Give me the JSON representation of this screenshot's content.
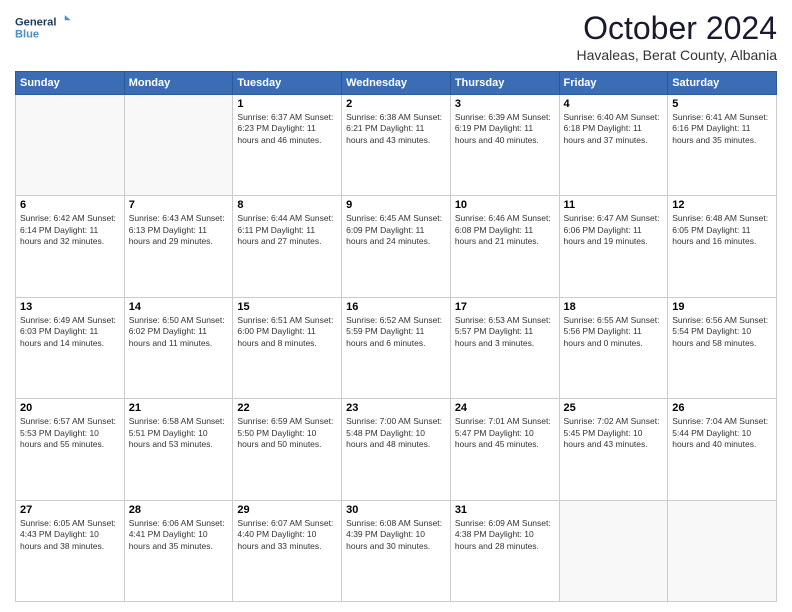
{
  "logo": {
    "line1": "General",
    "line2": "Blue",
    "icon_color": "#4a90c4"
  },
  "header": {
    "month_title": "October 2024",
    "subtitle": "Havaleas, Berat County, Albania"
  },
  "weekdays": [
    "Sunday",
    "Monday",
    "Tuesday",
    "Wednesday",
    "Thursday",
    "Friday",
    "Saturday"
  ],
  "weeks": [
    [
      {
        "day": "",
        "info": ""
      },
      {
        "day": "",
        "info": ""
      },
      {
        "day": "1",
        "info": "Sunrise: 6:37 AM\nSunset: 6:23 PM\nDaylight: 11 hours\nand 46 minutes."
      },
      {
        "day": "2",
        "info": "Sunrise: 6:38 AM\nSunset: 6:21 PM\nDaylight: 11 hours\nand 43 minutes."
      },
      {
        "day": "3",
        "info": "Sunrise: 6:39 AM\nSunset: 6:19 PM\nDaylight: 11 hours\nand 40 minutes."
      },
      {
        "day": "4",
        "info": "Sunrise: 6:40 AM\nSunset: 6:18 PM\nDaylight: 11 hours\nand 37 minutes."
      },
      {
        "day": "5",
        "info": "Sunrise: 6:41 AM\nSunset: 6:16 PM\nDaylight: 11 hours\nand 35 minutes."
      }
    ],
    [
      {
        "day": "6",
        "info": "Sunrise: 6:42 AM\nSunset: 6:14 PM\nDaylight: 11 hours\nand 32 minutes."
      },
      {
        "day": "7",
        "info": "Sunrise: 6:43 AM\nSunset: 6:13 PM\nDaylight: 11 hours\nand 29 minutes."
      },
      {
        "day": "8",
        "info": "Sunrise: 6:44 AM\nSunset: 6:11 PM\nDaylight: 11 hours\nand 27 minutes."
      },
      {
        "day": "9",
        "info": "Sunrise: 6:45 AM\nSunset: 6:09 PM\nDaylight: 11 hours\nand 24 minutes."
      },
      {
        "day": "10",
        "info": "Sunrise: 6:46 AM\nSunset: 6:08 PM\nDaylight: 11 hours\nand 21 minutes."
      },
      {
        "day": "11",
        "info": "Sunrise: 6:47 AM\nSunset: 6:06 PM\nDaylight: 11 hours\nand 19 minutes."
      },
      {
        "day": "12",
        "info": "Sunrise: 6:48 AM\nSunset: 6:05 PM\nDaylight: 11 hours\nand 16 minutes."
      }
    ],
    [
      {
        "day": "13",
        "info": "Sunrise: 6:49 AM\nSunset: 6:03 PM\nDaylight: 11 hours\nand 14 minutes."
      },
      {
        "day": "14",
        "info": "Sunrise: 6:50 AM\nSunset: 6:02 PM\nDaylight: 11 hours\nand 11 minutes."
      },
      {
        "day": "15",
        "info": "Sunrise: 6:51 AM\nSunset: 6:00 PM\nDaylight: 11 hours\nand 8 minutes."
      },
      {
        "day": "16",
        "info": "Sunrise: 6:52 AM\nSunset: 5:59 PM\nDaylight: 11 hours\nand 6 minutes."
      },
      {
        "day": "17",
        "info": "Sunrise: 6:53 AM\nSunset: 5:57 PM\nDaylight: 11 hours\nand 3 minutes."
      },
      {
        "day": "18",
        "info": "Sunrise: 6:55 AM\nSunset: 5:56 PM\nDaylight: 11 hours\nand 0 minutes."
      },
      {
        "day": "19",
        "info": "Sunrise: 6:56 AM\nSunset: 5:54 PM\nDaylight: 10 hours\nand 58 minutes."
      }
    ],
    [
      {
        "day": "20",
        "info": "Sunrise: 6:57 AM\nSunset: 5:53 PM\nDaylight: 10 hours\nand 55 minutes."
      },
      {
        "day": "21",
        "info": "Sunrise: 6:58 AM\nSunset: 5:51 PM\nDaylight: 10 hours\nand 53 minutes."
      },
      {
        "day": "22",
        "info": "Sunrise: 6:59 AM\nSunset: 5:50 PM\nDaylight: 10 hours\nand 50 minutes."
      },
      {
        "day": "23",
        "info": "Sunrise: 7:00 AM\nSunset: 5:48 PM\nDaylight: 10 hours\nand 48 minutes."
      },
      {
        "day": "24",
        "info": "Sunrise: 7:01 AM\nSunset: 5:47 PM\nDaylight: 10 hours\nand 45 minutes."
      },
      {
        "day": "25",
        "info": "Sunrise: 7:02 AM\nSunset: 5:45 PM\nDaylight: 10 hours\nand 43 minutes."
      },
      {
        "day": "26",
        "info": "Sunrise: 7:04 AM\nSunset: 5:44 PM\nDaylight: 10 hours\nand 40 minutes."
      }
    ],
    [
      {
        "day": "27",
        "info": "Sunrise: 6:05 AM\nSunset: 4:43 PM\nDaylight: 10 hours\nand 38 minutes."
      },
      {
        "day": "28",
        "info": "Sunrise: 6:06 AM\nSunset: 4:41 PM\nDaylight: 10 hours\nand 35 minutes."
      },
      {
        "day": "29",
        "info": "Sunrise: 6:07 AM\nSunset: 4:40 PM\nDaylight: 10 hours\nand 33 minutes."
      },
      {
        "day": "30",
        "info": "Sunrise: 6:08 AM\nSunset: 4:39 PM\nDaylight: 10 hours\nand 30 minutes."
      },
      {
        "day": "31",
        "info": "Sunrise: 6:09 AM\nSunset: 4:38 PM\nDaylight: 10 hours\nand 28 minutes."
      },
      {
        "day": "",
        "info": ""
      },
      {
        "day": "",
        "info": ""
      }
    ]
  ]
}
